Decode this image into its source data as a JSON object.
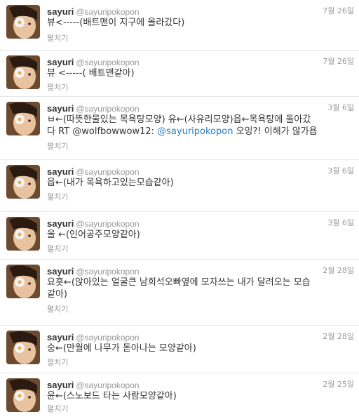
{
  "tweets": [
    {
      "name": "sayuri",
      "handle": "@sayuripokopon",
      "date": "7월 26일",
      "text": "뷰<-----(배트맨이 지구에 올라갔다)",
      "expand": "펼치기"
    },
    {
      "name": "sayuri",
      "handle": "@sayuripokopon",
      "date": "7월 26일",
      "text": "뷰 <-----( 배트맨같아)",
      "expand": "펼치기"
    },
    {
      "name": "sayuri",
      "handle": "@sayuripokopon",
      "date": "3월 6일",
      "text_line1": "ㅂ←(따뜻한물있는 목욕탕모양) 유←(사유리모양)읍←목욕탕에 돌아갔",
      "text_line2_pre": "다 RT @wolfbowwow12: ",
      "text_mention": "@sayuripokopon",
      "text_line2_post": " 오잉?! 이해가 않가욥",
      "expand": "펼치기"
    },
    {
      "name": "sayuri",
      "handle": "@sayuripokopon",
      "date": "3월 6일",
      "text": "읍←(내가 목욕하고있는모습같아)",
      "expand": "펼치기"
    },
    {
      "name": "sayuri",
      "handle": "@sayuripokopon",
      "date": "3월 6일",
      "text": "울 ←(인어공주모양같아)",
      "expand": "펼치기"
    },
    {
      "name": "sayuri",
      "handle": "@sayuripokopon",
      "date": "2월 28일",
      "text_line1": "요흣←(앉아있는 얼굴큰 남희석오빠옆에 모자쓰는 내가 달려오는 모습",
      "text_line2": "같아)",
      "expand": "펼치기"
    },
    {
      "name": "sayuri",
      "handle": "@sayuripokopon",
      "date": "2월 28일",
      "text": "숭←(만월에 나무가 돋아나는 모양같아)",
      "expand": "펼치기"
    },
    {
      "name": "sayuri",
      "handle": "@sayuripokopon",
      "date": "2월 25일",
      "text": "윤←(스노보드 타는 사람모양같아)",
      "expand": "펼치기"
    }
  ]
}
